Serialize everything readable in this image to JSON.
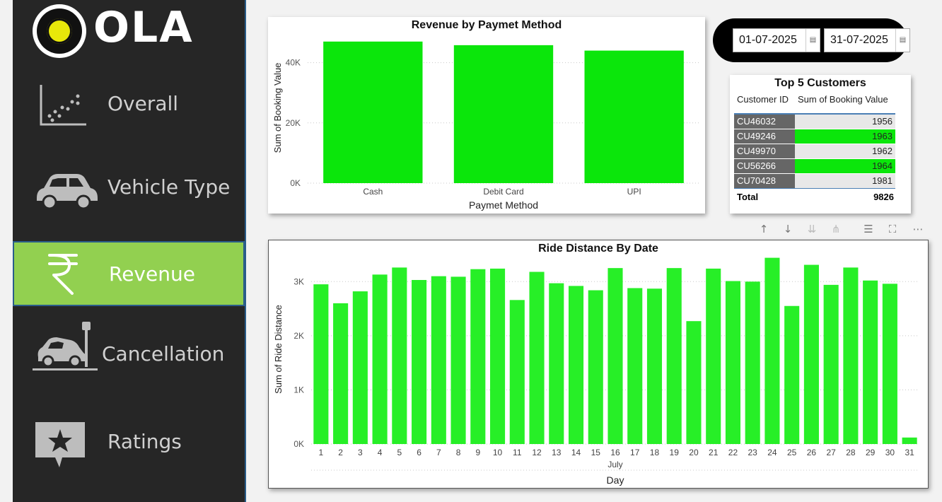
{
  "sidebar": {
    "logo_text": "OLA",
    "items": [
      {
        "label": "Overall",
        "icon": "scatter-chart-icon",
        "active": false
      },
      {
        "label": "Vehicle Type",
        "icon": "car-icon",
        "active": false
      },
      {
        "label": "Revenue",
        "icon": "rupee-icon",
        "active": true
      },
      {
        "label": "Cancellation",
        "icon": "car-crash-icon",
        "active": false
      },
      {
        "label": "Ratings",
        "icon": "star-rating-icon",
        "active": false
      }
    ],
    "active_color": "#92d050"
  },
  "date_filter": {
    "start": "01-07-2025",
    "end": "31-07-2025"
  },
  "top_customers": {
    "title": "Top 5 Customers",
    "col_id": "Customer ID",
    "col_value": "Sum of Booking Value",
    "rows": [
      {
        "id": "CU46032",
        "value": "1956",
        "highlight": false
      },
      {
        "id": "CU49246",
        "value": "1963",
        "highlight": true
      },
      {
        "id": "CU49970",
        "value": "1962",
        "highlight": false
      },
      {
        "id": "CU56266",
        "value": "1964",
        "highlight": true
      },
      {
        "id": "CU70428",
        "value": "1981",
        "highlight": false
      }
    ],
    "total_label": "Total",
    "total_value": "9826"
  },
  "toolbar_icons": [
    "sort-up-icon",
    "sort-down-icon",
    "drill-down-icon",
    "expand-hierarchy-icon",
    "filter-icon",
    "focus-mode-icon",
    "more-options-icon"
  ],
  "chart_data": [
    {
      "type": "bar",
      "title": "Revenue by Paymet Method",
      "xlabel": "Paymet Method",
      "ylabel": "Sum of Booking Value",
      "categories": [
        "Cash",
        "Debit Card",
        "UPI"
      ],
      "values": [
        47000,
        45800,
        44000
      ],
      "yticks": [
        "0K",
        "20K",
        "40K"
      ],
      "ylim": [
        0,
        50000
      ],
      "color": "#0be60b",
      "grid": true
    },
    {
      "type": "bar",
      "title": "Ride Distance By Date",
      "xlabel": "Day",
      "x_group_label": "July",
      "ylabel": "Sum of Ride Distance",
      "categories": [
        "1",
        "2",
        "3",
        "4",
        "5",
        "6",
        "7",
        "8",
        "9",
        "10",
        "11",
        "12",
        "13",
        "14",
        "15",
        "16",
        "17",
        "18",
        "19",
        "20",
        "21",
        "22",
        "23",
        "24",
        "25",
        "26",
        "27",
        "28",
        "29",
        "30",
        "31"
      ],
      "values": [
        2950,
        2600,
        2820,
        3130,
        3260,
        3030,
        3100,
        3090,
        3230,
        3240,
        2660,
        3180,
        2970,
        2920,
        2840,
        3250,
        2880,
        2870,
        3250,
        2270,
        3240,
        3010,
        3000,
        3440,
        2550,
        3310,
        2940,
        3260,
        3020,
        2960,
        120
      ],
      "yticks": [
        "0K",
        "1K",
        "2K",
        "3K"
      ],
      "ylim": [
        0,
        3500
      ],
      "color": "#27ef27",
      "grid": true
    }
  ]
}
